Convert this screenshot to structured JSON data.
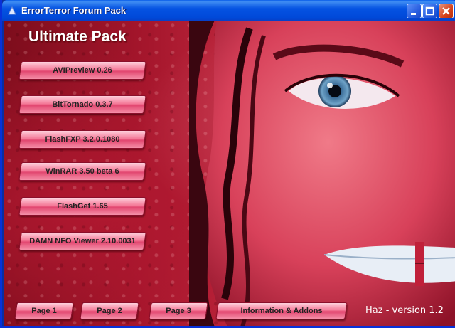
{
  "window": {
    "title": "ErrorTerror Forum Pack"
  },
  "pack_title": "Ultimate Pack",
  "apps": [
    {
      "label": "AVIPreview 0.26"
    },
    {
      "label": "BitTornado 0.3.7"
    },
    {
      "label": "FlashFXP 3.2.0.1080"
    },
    {
      "label": "WinRAR 3.50 beta 6"
    },
    {
      "label": "FlashGet 1.65"
    },
    {
      "label": "DAMN NFO Viewer 2.10.0031"
    }
  ],
  "nav": [
    {
      "label": "Page 1"
    },
    {
      "label": "Page 2"
    },
    {
      "label": "Page 3"
    },
    {
      "label": "Information & Addons"
    }
  ],
  "version_text": "Haz  - version 1.2",
  "colors": {
    "title_bar": "#0054e3",
    "button_pink": "#f47a98",
    "background_red": "#b01830"
  }
}
